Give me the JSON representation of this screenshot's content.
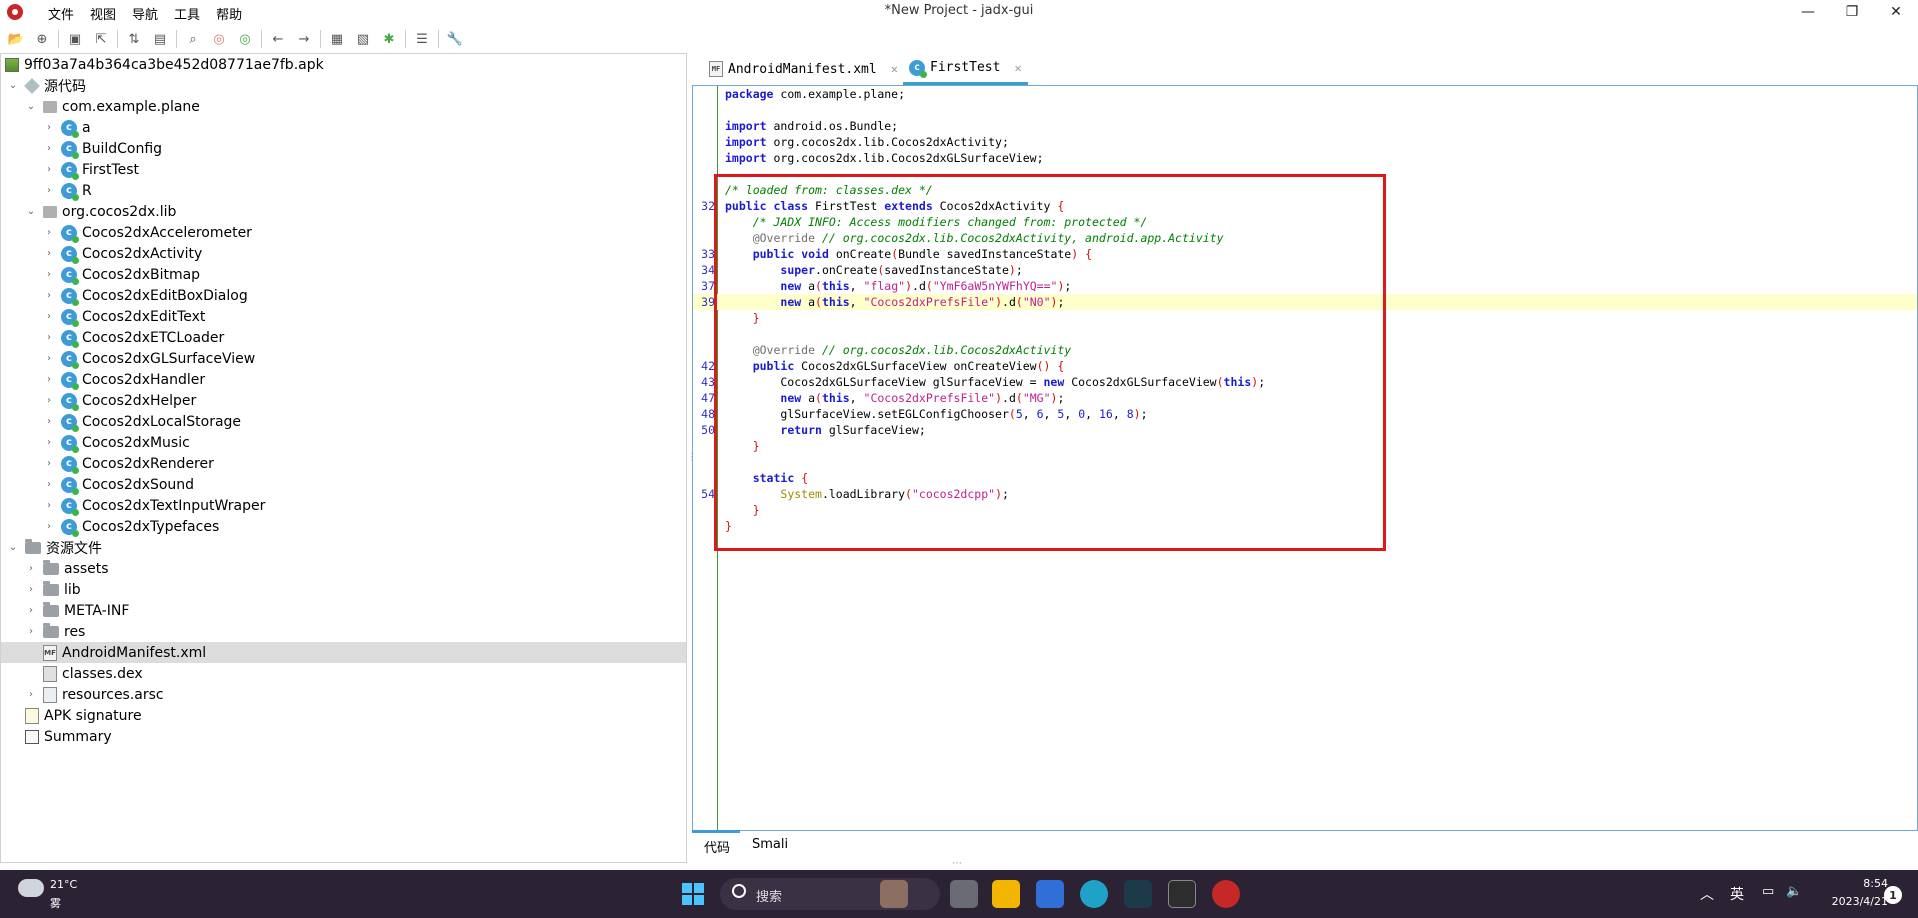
{
  "window": {
    "title": "*New Project - jadx-gui",
    "controls": [
      "—",
      "❐",
      "✕"
    ]
  },
  "menu": [
    "文件",
    "视图",
    "导航",
    "工具",
    "帮助"
  ],
  "toolbar_icons": [
    "open-icon",
    "add-files-icon",
    "save-icon",
    "export-icon",
    "sync-tree-icon",
    "flatten-packages-icon",
    "search-icon",
    "find-class-icon",
    "find-usage-icon",
    "back-icon",
    "forward-icon",
    "log-icon",
    "deobfuscation-icon",
    "debugger-icon",
    "log-viewer-icon",
    "preferences-icon"
  ],
  "tree": {
    "root": "9ff03a7a4b364ca3be452d08771ae7fb.apk",
    "items": [
      {
        "label": "源代码",
        "icon": "source-folder-icon",
        "depth": 0,
        "expanded": true
      },
      {
        "label": "com.example.plane",
        "icon": "package-icon",
        "depth": 1,
        "expanded": true
      },
      {
        "label": "a",
        "icon": "class-icon",
        "depth": 2
      },
      {
        "label": "BuildConfig",
        "icon": "class-icon",
        "depth": 2
      },
      {
        "label": "FirstTest",
        "icon": "class-icon",
        "depth": 2
      },
      {
        "label": "R",
        "icon": "class-icon",
        "depth": 2
      },
      {
        "label": "org.cocos2dx.lib",
        "icon": "package-icon",
        "depth": 1,
        "expanded": true
      },
      {
        "label": "Cocos2dxAccelerometer",
        "icon": "class-icon",
        "depth": 2
      },
      {
        "label": "Cocos2dxActivity",
        "icon": "class-icon",
        "depth": 2
      },
      {
        "label": "Cocos2dxBitmap",
        "icon": "class-icon",
        "depth": 2
      },
      {
        "label": "Cocos2dxEditBoxDialog",
        "icon": "class-icon",
        "depth": 2
      },
      {
        "label": "Cocos2dxEditText",
        "icon": "class-icon",
        "depth": 2
      },
      {
        "label": "Cocos2dxETCLoader",
        "icon": "class-icon",
        "depth": 2
      },
      {
        "label": "Cocos2dxGLSurfaceView",
        "icon": "class-icon",
        "depth": 2
      },
      {
        "label": "Cocos2dxHandler",
        "icon": "class-icon",
        "depth": 2
      },
      {
        "label": "Cocos2dxHelper",
        "icon": "class-icon",
        "depth": 2
      },
      {
        "label": "Cocos2dxLocalStorage",
        "icon": "class-icon",
        "depth": 2
      },
      {
        "label": "Cocos2dxMusic",
        "icon": "class-icon",
        "depth": 2
      },
      {
        "label": "Cocos2dxRenderer",
        "icon": "class-icon",
        "depth": 2
      },
      {
        "label": "Cocos2dxSound",
        "icon": "class-icon",
        "depth": 2
      },
      {
        "label": "Cocos2dxTextInputWraper",
        "icon": "class-icon",
        "depth": 2
      },
      {
        "label": "Cocos2dxTypefaces",
        "icon": "class-icon",
        "depth": 2
      },
      {
        "label": "资源文件",
        "icon": "resources-folder-icon",
        "depth": 0,
        "expanded": true
      },
      {
        "label": "assets",
        "icon": "folder-icon",
        "depth": 1
      },
      {
        "label": "lib",
        "icon": "folder-icon",
        "depth": 1
      },
      {
        "label": "META-INF",
        "icon": "folder-icon",
        "depth": 1
      },
      {
        "label": "res",
        "icon": "folder-icon",
        "depth": 1
      },
      {
        "label": "AndroidManifest.xml",
        "icon": "manifest-icon",
        "depth": 1,
        "selected": true
      },
      {
        "label": "classes.dex",
        "icon": "dex-icon",
        "depth": 1
      },
      {
        "label": "resources.arsc",
        "icon": "arsc-icon",
        "depth": 1
      },
      {
        "label": "APK signature",
        "icon": "signature-icon",
        "depth": 0
      },
      {
        "label": "Summary",
        "icon": "summary-icon",
        "depth": 0
      }
    ]
  },
  "tabs": [
    {
      "label": "AndroidManifest.xml",
      "icon": "manifest-icon",
      "active": false
    },
    {
      "label": "FirstTest",
      "icon": "class-icon",
      "active": true
    }
  ],
  "code": [
    {
      "ln": "",
      "text": "package com.example.plane;"
    },
    {
      "ln": "",
      "text": ""
    },
    {
      "ln": "",
      "text": "import android.os.Bundle;"
    },
    {
      "ln": "",
      "text": "import org.cocos2dx.lib.Cocos2dxActivity;"
    },
    {
      "ln": "",
      "text": "import org.cocos2dx.lib.Cocos2dxGLSurfaceView;"
    },
    {
      "ln": "",
      "text": ""
    },
    {
      "ln": "",
      "text": "/* loaded from: classes.dex */"
    },
    {
      "ln": "32",
      "text": "public class FirstTest extends Cocos2dxActivity {"
    },
    {
      "ln": "",
      "text": "    /* JADX INFO: Access modifiers changed from: protected */"
    },
    {
      "ln": "",
      "text": "    @Override // org.cocos2dx.lib.Cocos2dxActivity, android.app.Activity"
    },
    {
      "ln": "33",
      "text": "    public void onCreate(Bundle savedInstanceState) {"
    },
    {
      "ln": "34",
      "text": "        super.onCreate(savedInstanceState);"
    },
    {
      "ln": "37",
      "text": "        new a(this, \"flag\").d(\"YmF6aW5nYWFhYQ==\");"
    },
    {
      "ln": "39",
      "text": "        new a(this, \"Cocos2dxPrefsFile\").d(\"N0\");"
    },
    {
      "ln": "",
      "text": "    }"
    },
    {
      "ln": "",
      "text": ""
    },
    {
      "ln": "",
      "text": "    @Override // org.cocos2dx.lib.Cocos2dxActivity"
    },
    {
      "ln": "42",
      "text": "    public Cocos2dxGLSurfaceView onCreateView() {"
    },
    {
      "ln": "43",
      "text": "        Cocos2dxGLSurfaceView glSurfaceView = new Cocos2dxGLSurfaceView(this);"
    },
    {
      "ln": "47",
      "text": "        new a(this, \"Cocos2dxPrefsFile\").d(\"MG\");"
    },
    {
      "ln": "48",
      "text": "        glSurfaceView.setEGLConfigChooser(5, 6, 5, 0, 16, 8);"
    },
    {
      "ln": "50",
      "text": "        return glSurfaceView;"
    },
    {
      "ln": "",
      "text": "    }"
    },
    {
      "ln": "",
      "text": ""
    },
    {
      "ln": "",
      "text": "    static {"
    },
    {
      "ln": "54",
      "text": "        System.loadLibrary(\"cocos2dcpp\");"
    },
    {
      "ln": "",
      "text": "    }"
    },
    {
      "ln": "",
      "text": "}"
    }
  ],
  "highlight_line_index": 13,
  "bottom_tabs": [
    "代码",
    "Smali"
  ],
  "taskbar": {
    "weather_temp": "21°C",
    "weather_desc": "雾",
    "search_placeholder": "搜索",
    "ime": "英",
    "time": "8:54",
    "date": "2023/4/21",
    "notifications": "1",
    "apps": [
      "file-manager-icon",
      "task-view-icon",
      "explorer-icon",
      "store-icon",
      "edge-icon",
      "nox-icon",
      "terminal-icon",
      "jadx-icon"
    ]
  },
  "colors": {
    "accent": "#3d9cd6",
    "annotation_box": "#e01818",
    "highlight": "#ffffcc"
  }
}
